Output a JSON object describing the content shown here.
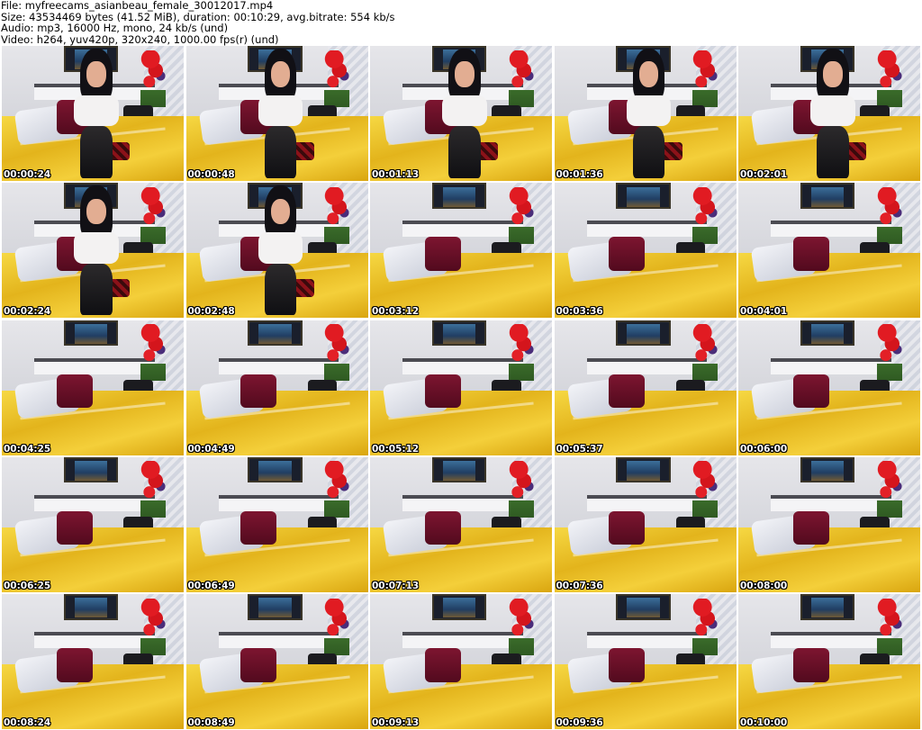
{
  "header": {
    "file_line": "File: myfreecams_asianbeau_female_30012017.mp4",
    "size_line": "Size: 43534469 bytes (41.52 MiB), duration: 00:10:29, avg.bitrate: 554 kb/s",
    "audio_line": "Audio: mp3, 16000 Hz, mono, 24 kb/s (und)",
    "video_line": "Video: h264, yuv420p, 320x240, 1000.00 fps(r) (und)"
  },
  "thumbnails": [
    {
      "timestamp": "00:00:24",
      "has_person": true
    },
    {
      "timestamp": "00:00:48",
      "has_person": true
    },
    {
      "timestamp": "00:01:13",
      "has_person": true
    },
    {
      "timestamp": "00:01:36",
      "has_person": true
    },
    {
      "timestamp": "00:02:01",
      "has_person": true
    },
    {
      "timestamp": "00:02:24",
      "has_person": true
    },
    {
      "timestamp": "00:02:48",
      "has_person": true
    },
    {
      "timestamp": "00:03:12",
      "has_person": false
    },
    {
      "timestamp": "00:03:36",
      "has_person": false
    },
    {
      "timestamp": "00:04:01",
      "has_person": false
    },
    {
      "timestamp": "00:04:25",
      "has_person": false
    },
    {
      "timestamp": "00:04:49",
      "has_person": false
    },
    {
      "timestamp": "00:05:12",
      "has_person": false
    },
    {
      "timestamp": "00:05:37",
      "has_person": false
    },
    {
      "timestamp": "00:06:00",
      "has_person": false
    },
    {
      "timestamp": "00:06:25",
      "has_person": false
    },
    {
      "timestamp": "00:06:49",
      "has_person": false
    },
    {
      "timestamp": "00:07:13",
      "has_person": false
    },
    {
      "timestamp": "00:07:36",
      "has_person": false
    },
    {
      "timestamp": "00:08:00",
      "has_person": false
    },
    {
      "timestamp": "00:08:24",
      "has_person": false
    },
    {
      "timestamp": "00:08:49",
      "has_person": false
    },
    {
      "timestamp": "00:09:13",
      "has_person": false
    },
    {
      "timestamp": "00:09:36",
      "has_person": false
    },
    {
      "timestamp": "00:10:00",
      "has_person": false
    }
  ],
  "colors": {
    "background": "#ffffff",
    "header_text": "#000000",
    "timestamp_text": "#ffffff",
    "timestamp_outline": "#000000",
    "bedsheet": "#f4cf3a",
    "pillow_red": "#7d1530"
  }
}
